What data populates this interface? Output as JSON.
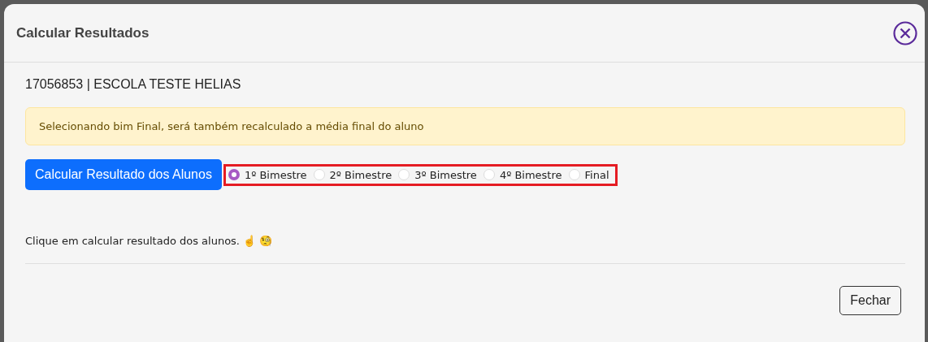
{
  "modal": {
    "title": "Calcular Resultados",
    "school": "17056853 | ESCOLA TESTE HELIAS",
    "alert": "Selecionando bim Final, será também recalculado a média final do aluno",
    "calc_button": "Calcular Resultado dos Alunos",
    "options": [
      {
        "label": "1º Bimestre",
        "selected": true
      },
      {
        "label": "2º Bimestre",
        "selected": false
      },
      {
        "label": "3º Bimestre",
        "selected": false
      },
      {
        "label": "4º Bimestre",
        "selected": false
      },
      {
        "label": "Final",
        "selected": false
      }
    ],
    "message": "Clique em calcular resultado dos alunos. ☝️ 🧐",
    "close_button": "Fechar"
  }
}
